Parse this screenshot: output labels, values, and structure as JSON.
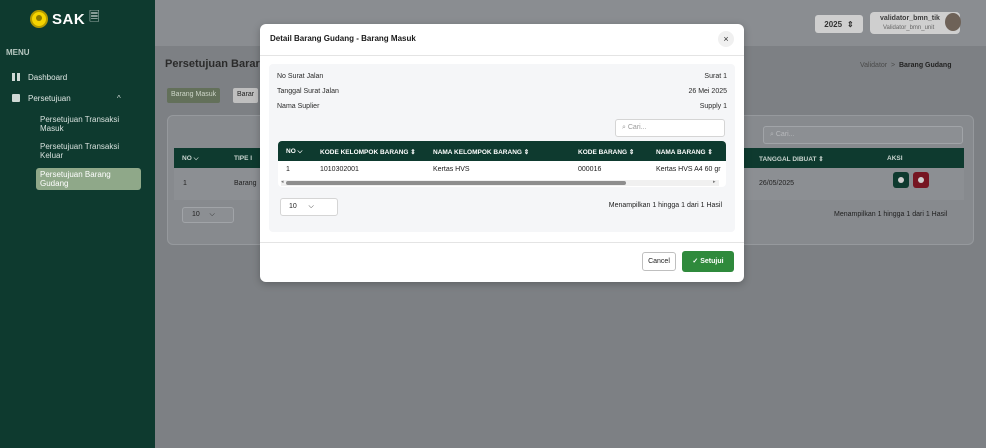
{
  "app": {
    "logo_text": "SAK",
    "logo_suffix": "🗏"
  },
  "sidebar": {
    "menu_label": "MENU",
    "items": [
      {
        "label": "Dashboard"
      },
      {
        "label": "Persetujuan",
        "chevron": "^"
      }
    ],
    "sub_items": [
      {
        "label": "Persetujuan Transaksi Masuk"
      },
      {
        "label": "Persetujuan Transaksi Keluar"
      },
      {
        "label": "Persetujuan Barang Gudang"
      }
    ]
  },
  "header": {
    "year": "2025",
    "year_arrow": "⇕",
    "user_name": "validator_bmn_tik",
    "user_role": "Validator_bmn_unit"
  },
  "page": {
    "title": "Persetujuan Barar",
    "breadcrumb": {
      "parent": "Validator",
      "separator": ">",
      "current": "Barang Gudang"
    },
    "tabs": [
      "Barang Masuk",
      "Barar"
    ],
    "search_placeholder": "Cari...",
    "table": {
      "headers": [
        "NO",
        "TIPE I",
        "TANGGAL DIBUAT",
        "AKSI"
      ],
      "sort_indicators": [
        "⌵",
        "⇕"
      ],
      "row": {
        "no": "1",
        "tipe": "Barang",
        "tanggal": "26/05/2025"
      }
    },
    "page_size": "10",
    "page_size_arrow": "⌵",
    "pagination_info": "Menampilkan 1 hingga 1 dari 1 Hasil"
  },
  "modal": {
    "title": "Detail Barang Gudang - Barang Masuk",
    "close": "×",
    "info": [
      {
        "label": "No Surat Jalan",
        "value": "Surat 1"
      },
      {
        "label": "Tanggal Surat Jalan",
        "value": "26 Mei 2025"
      },
      {
        "label": "Nama Suplier",
        "value": "Supply 1"
      }
    ],
    "search_placeholder": "Cari...",
    "table": {
      "headers": [
        "NO ⌵",
        "KODE KELOMPOK BARANG ⇕",
        "NAMA KELOMPOK BARANG ⇕",
        "KODE BARANG ⇕",
        "NAMA BARANG ⇕"
      ],
      "row": [
        "1",
        "1010302001",
        "Kertas HVS",
        "000016",
        "Kertas HVS A4 60 gr"
      ]
    },
    "page_size": "10",
    "page_size_arrow": "⌵",
    "pagination_info": "Menampilkan 1 hingga 1 dari 1 Hasil",
    "cancel_label": "Cancel",
    "approve_label": "✓  Setujui"
  }
}
